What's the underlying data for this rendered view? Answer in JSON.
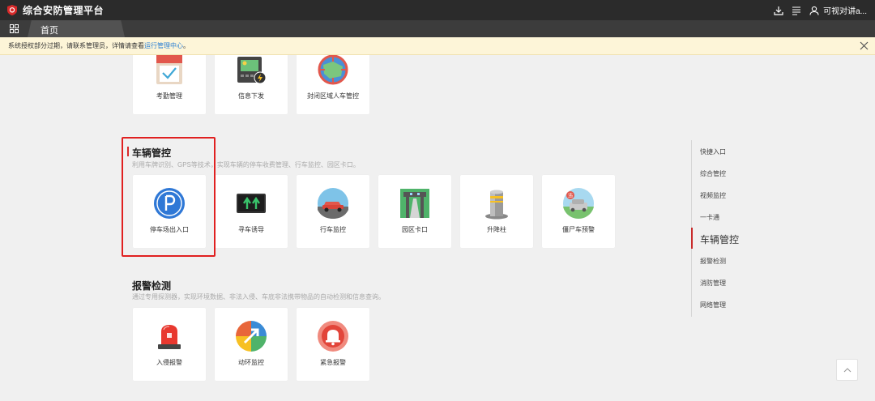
{
  "header": {
    "title": "综合安防管理平台",
    "user_name": "可视对讲a...",
    "brand_color": "#d82a2a"
  },
  "tabs": [
    {
      "label": "首页"
    }
  ],
  "notice": {
    "text": "系统授权部分过期，请联系管理员，详情请查看",
    "link": "运行管理中心",
    "suffix": "。"
  },
  "top_cards": [
    {
      "label": "考勤管理",
      "icon": "calendar-icon"
    },
    {
      "label": "信息下发",
      "icon": "image-lightning-icon"
    },
    {
      "label": "封闭区域人车管控",
      "icon": "map-target-icon"
    }
  ],
  "vehicle_section": {
    "title": "车辆管控",
    "desc": "利用车牌识别、GPS等技术，实现车辆的停车收费管理、行车监控、园区卡口。",
    "cards": [
      {
        "label": "停车场出入口",
        "icon": "parking-icon"
      },
      {
        "label": "寻车诱导",
        "icon": "guidance-arrows-icon"
      },
      {
        "label": "行车监控",
        "icon": "car-monitor-icon"
      },
      {
        "label": "园区卡口",
        "icon": "park-gate-icon"
      },
      {
        "label": "升降柱",
        "icon": "bollard-icon"
      },
      {
        "label": "僵尸车预警",
        "icon": "zombie-car-icon"
      }
    ]
  },
  "alarm_section": {
    "title": "报警检测",
    "desc": "通过专用探测器，实现环境数据、非法入侵、车底非法携带物品的自动检测和信息查询。",
    "cards": [
      {
        "label": "入侵报警",
        "icon": "siren-icon"
      },
      {
        "label": "动环监控",
        "icon": "dynamic-env-icon"
      },
      {
        "label": "紧急报警",
        "icon": "emergency-bell-icon"
      }
    ]
  },
  "side_nav": [
    {
      "label": "快捷入口",
      "active": false
    },
    {
      "label": "综合管控",
      "active": false
    },
    {
      "label": "视频监控",
      "active": false
    },
    {
      "label": "一卡通",
      "active": false
    },
    {
      "label": "车辆管控",
      "active": true
    },
    {
      "label": "报警检测",
      "active": false
    },
    {
      "label": "消防管理",
      "active": false
    },
    {
      "label": "网络管理",
      "active": false
    }
  ]
}
